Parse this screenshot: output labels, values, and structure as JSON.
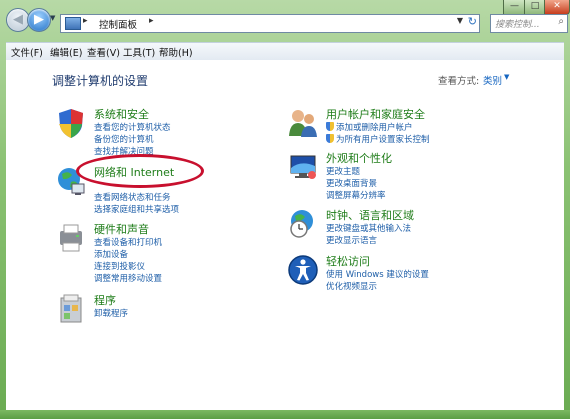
{
  "address": {
    "path_segment": "控制面板",
    "search_placeholder": "搜索控制..."
  },
  "menu": [
    "文件(F)",
    "编辑(E)",
    "查看(V)",
    "工具(T)",
    "帮助(H)"
  ],
  "page_title": "调整计算机的设置",
  "view": {
    "label": "查看方式:",
    "value": "类别"
  },
  "categories": [
    {
      "title": "系统和安全",
      "links": [
        "查看您的计算机状态",
        "备份您的计算机",
        "查找并解决问题"
      ]
    },
    {
      "title": "网络和 Internet",
      "links": [
        "查看网络状态和任务",
        "选择家庭组和共享选项"
      ]
    },
    {
      "title": "硬件和声音",
      "links": [
        "查看设备和打印机",
        "添加设备",
        "连接到投影仪",
        "调整常用移动设置"
      ]
    },
    {
      "title": "程序",
      "links": [
        "卸载程序"
      ]
    },
    {
      "title": "用户帐户和家庭安全",
      "links": [
        "添加或删除用户帐户",
        "为所有用户设置家长控制"
      ]
    },
    {
      "title": "外观和个性化",
      "links": [
        "更改主题",
        "更改桌面背景",
        "调整屏幕分辨率"
      ]
    },
    {
      "title": "时钟、语言和区域",
      "links": [
        "更改键盘或其他输入法",
        "更改显示语言"
      ]
    },
    {
      "title": "轻松访问",
      "links": [
        "使用 Windows 建议的设置",
        "优化视频显示"
      ]
    }
  ],
  "colors": {
    "link": "#1f5fa8",
    "category_title": "#1e7c18",
    "highlight": "#c8102e",
    "window_frame": "#8bc273"
  }
}
